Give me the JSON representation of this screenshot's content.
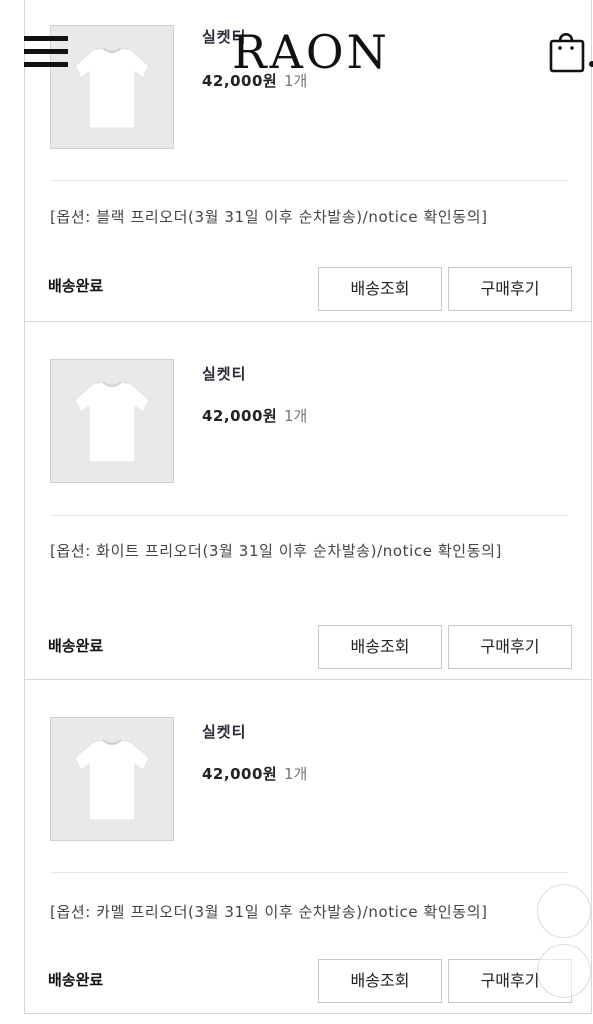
{
  "header": {
    "logo": "RAON",
    "menu_icon": "hamburger-menu-icon",
    "cart_icon": "shopping-bag-icon"
  },
  "orders": [
    {
      "product_name": "실켓티",
      "price": "42,000원",
      "quantity": "1개",
      "option": "[옵션: 블랙 프리오더(3월 31일 이후 순차발송)/notice 확인동의]",
      "status": "배송완료",
      "track_label": "배송조회",
      "review_label": "구매후기"
    },
    {
      "product_name": "실켓티",
      "price": "42,000원",
      "quantity": "1개",
      "option": "[옵션: 화이트 프리오더(3월 31일 이후 순차발송)/notice 확인동의]",
      "status": "배송완료",
      "track_label": "배송조회",
      "review_label": "구매후기"
    },
    {
      "product_name": "실켓티",
      "price": "42,000원",
      "quantity": "1개",
      "option": "[옵션: 카멜 프리오더(3월 31일 이후 순차발송)/notice 확인동의]",
      "status": "배송완료",
      "track_label": "배송조회",
      "review_label": "구매후기"
    }
  ],
  "colors": {
    "border": "#d6d6d6",
    "thumb_bg": "#e9e9e9",
    "text": "#222222"
  }
}
